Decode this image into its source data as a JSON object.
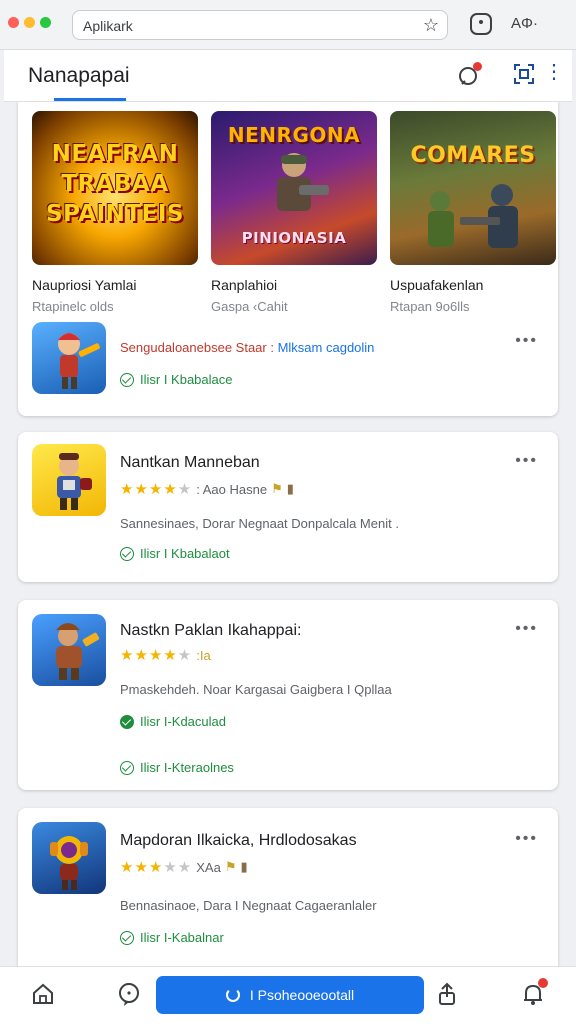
{
  "browser": {
    "url": "Aplikark",
    "profile_label": "AΦ·",
    "dot_colors": [
      "#ff5f57",
      "#febc2e",
      "#28c840"
    ]
  },
  "app": {
    "title": "Nanapapai",
    "accent": "#1a73e8"
  },
  "featured": [
    {
      "thumb_text": "NEAFRAN TRABAA SPAINTEIS",
      "title": "Naupriosi Yamlai",
      "subtitle": "Rtapinelc olds"
    },
    {
      "thumb_text_top": "NENRGONA",
      "thumb_text_bottom": "PINIONASIA",
      "title": "Ranplahioi",
      "subtitle": "Gaspa ‹Cahit"
    },
    {
      "thumb_text": "COMARES",
      "title": "Uspuafakenlan",
      "subtitle": "Rtapan 9o6lls"
    }
  ],
  "promo_row": {
    "text_primary": "Sengudaloanebsee Staar :",
    "text_link": "Mlksam cagdolin",
    "status": "Ilisr I Kbabalace"
  },
  "apps": [
    {
      "name": "Nantkan Manneban",
      "stars": 4,
      "rating_text": ": Aao Hasne",
      "description": "Sannesinaes, Dorar Negnaat Donpalcala Menit .",
      "statuses": [
        "Ilisr I Kbabalaot"
      ]
    },
    {
      "name": "Nastkn Paklan Ikahappai:",
      "stars": 4,
      "rating_text": ":Ia",
      "description": "Pmaskehdeh. Noar Kargasai Gaigbera I Qpllaa",
      "statuses": [
        "Ilisr I-Kdaculad",
        "Ilisr I-Kteraolnes"
      ]
    },
    {
      "name": "Mapdoran Ilkaicka, Hrdlodosakas",
      "stars": 3,
      "rating_text": "XAa",
      "description": "Bennasinaoe, Dara I Negnaat Cagaeranlaler",
      "statuses": [
        "Ilisr I-Kabalnar"
      ]
    }
  ],
  "bottom": {
    "cta_label": "I Psoheooeootall"
  }
}
